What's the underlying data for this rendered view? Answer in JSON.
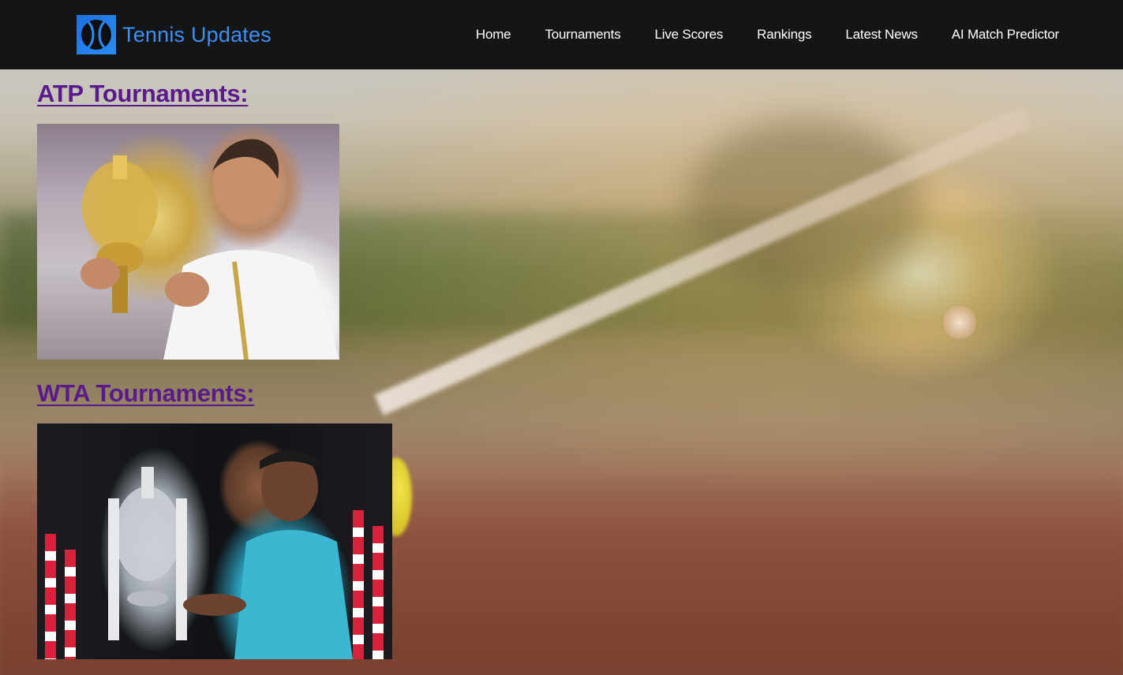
{
  "brand": {
    "name": "Tennis Updates",
    "logo_icon": "tennis-ball-icon",
    "accent_color": "#3f8ff0"
  },
  "nav": {
    "items": [
      {
        "label": "Home"
      },
      {
        "label": "Tournaments"
      },
      {
        "label": "Live Scores"
      },
      {
        "label": "Rankings"
      },
      {
        "label": "Latest News"
      },
      {
        "label": "AI Match Predictor"
      }
    ]
  },
  "sections": {
    "atp": {
      "heading": "ATP Tournaments:",
      "image_icon": "atp-champion-photo"
    },
    "wta": {
      "heading": "WTA Tournaments:",
      "image_icon": "wta-champion-photo"
    }
  },
  "colors": {
    "navbar_bg": "#141517",
    "heading_link": "#5a1a8c"
  }
}
